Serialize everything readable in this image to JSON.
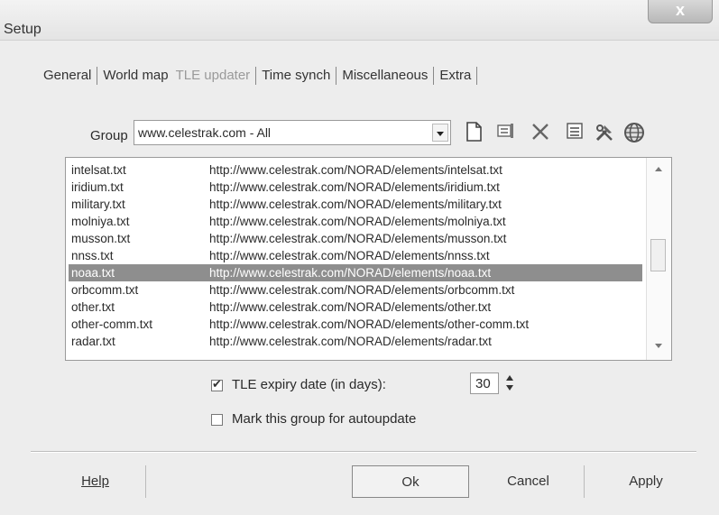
{
  "window": {
    "title": "Setup",
    "close_label": "x"
  },
  "tabs": [
    {
      "label": "General"
    },
    {
      "label": "World map"
    },
    {
      "label": "TLE updater"
    },
    {
      "label": "Time synch"
    },
    {
      "label": "Miscellaneous"
    },
    {
      "label": "Extra"
    }
  ],
  "group": {
    "label": "Group",
    "value": "www.celestrak.com - All"
  },
  "toolbar_icons": [
    "new-file-icon",
    "edit-icon",
    "delete-icon",
    "list-icon",
    "tools-icon",
    "globe-icon"
  ],
  "list": {
    "rows": [
      {
        "name": "intelsat.txt",
        "url": "http://www.celestrak.com/NORAD/elements/intelsat.txt"
      },
      {
        "name": "iridium.txt",
        "url": "http://www.celestrak.com/NORAD/elements/iridium.txt"
      },
      {
        "name": "military.txt",
        "url": "http://www.celestrak.com/NORAD/elements/military.txt"
      },
      {
        "name": "molniya.txt",
        "url": "http://www.celestrak.com/NORAD/elements/molniya.txt"
      },
      {
        "name": "musson.txt",
        "url": "http://www.celestrak.com/NORAD/elements/musson.txt"
      },
      {
        "name": "nnss.txt",
        "url": "http://www.celestrak.com/NORAD/elements/nnss.txt"
      },
      {
        "name": "noaa.txt",
        "url": "http://www.celestrak.com/NORAD/elements/noaa.txt",
        "selected": true
      },
      {
        "name": "orbcomm.txt",
        "url": "http://www.celestrak.com/NORAD/elements/orbcomm.txt"
      },
      {
        "name": "other.txt",
        "url": "http://www.celestrak.com/NORAD/elements/other.txt"
      },
      {
        "name": "other-comm.txt",
        "url": "http://www.celestrak.com/NORAD/elements/other-comm.txt"
      },
      {
        "name": "radar.txt",
        "url": "http://www.celestrak.com/NORAD/elements/radar.txt"
      }
    ]
  },
  "options": {
    "expiry_label": "TLE expiry date (in days):",
    "expiry_checked": true,
    "expiry_value": "30",
    "autoupdate_label": "Mark this group for autoupdate",
    "autoupdate_checked": false
  },
  "buttons": {
    "help": "Help",
    "ok": "Ok",
    "cancel": "Cancel",
    "apply": "Apply"
  }
}
